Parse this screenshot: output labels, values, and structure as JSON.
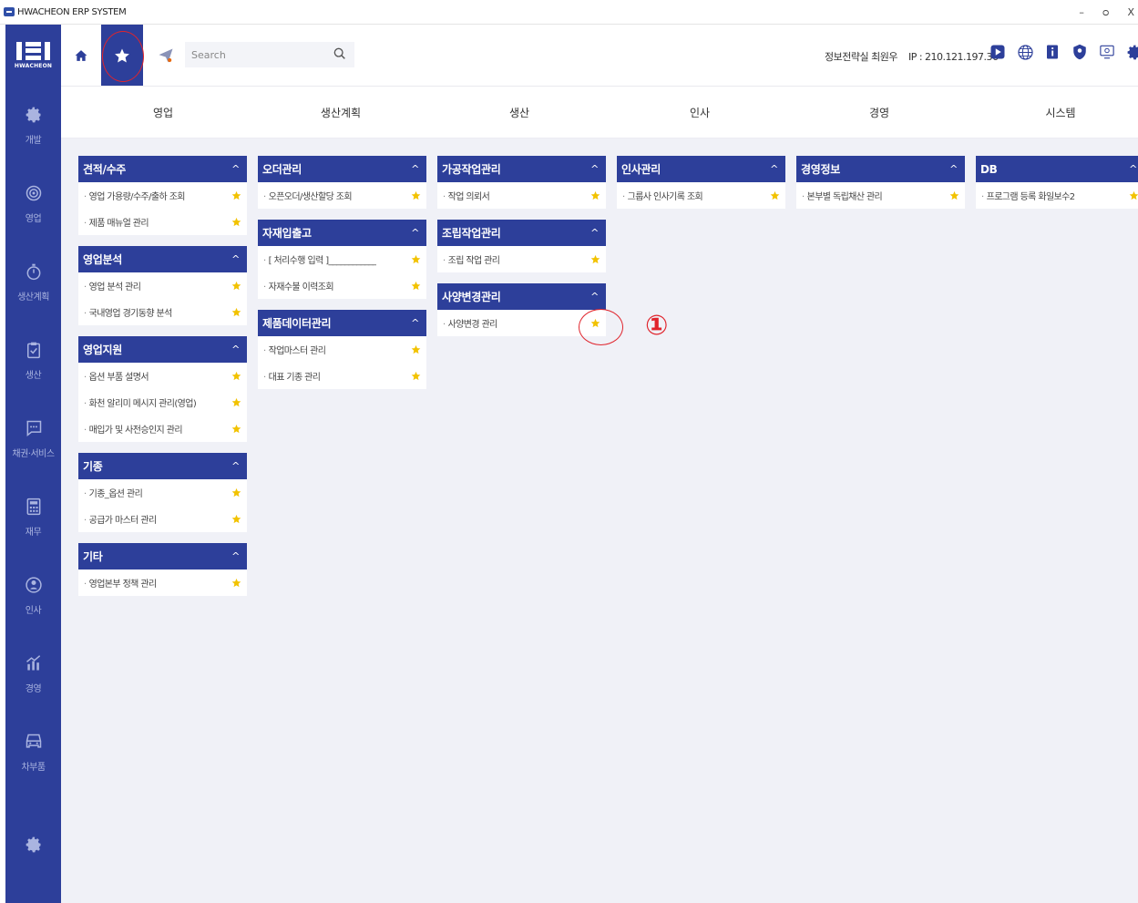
{
  "window": {
    "title": "HWACHEON ERP SYSTEM",
    "controls": [
      "–",
      "ᴑ",
      "X"
    ]
  },
  "sidebar": {
    "brand": "HWACHEON",
    "items": [
      {
        "label": "개발",
        "icon": "gear-bolt-icon"
      },
      {
        "label": "영업",
        "icon": "target-icon"
      },
      {
        "label": "생산계획",
        "icon": "stopwatch-icon"
      },
      {
        "label": "생산",
        "icon": "clipboard-icon"
      },
      {
        "label": "채권·서비스",
        "icon": "chat-bubble-icon"
      },
      {
        "label": "재무",
        "icon": "calculator-icon"
      },
      {
        "label": "인사",
        "icon": "person-icon"
      },
      {
        "label": "경영",
        "icon": "chart-icon"
      },
      {
        "label": "차부품",
        "icon": "car-icon"
      }
    ],
    "settings_icon": "gear-icon"
  },
  "toolbar": {
    "search_placeholder": "Search",
    "user": "정보전략실 최원우",
    "ip": "IP : 210.121.197.36",
    "icons": [
      "play-icon",
      "globe-icon",
      "info-book-icon",
      "shield-icon",
      "monitor-icon",
      "settings-icon"
    ]
  },
  "modules": [
    "영업",
    "생산계획",
    "생산",
    "인사",
    "경영",
    "시스템"
  ],
  "columns": [
    {
      "groups": [
        {
          "title": "견적/수주",
          "items": [
            "영업 가용량/수주/출하 조회",
            "제품 매뉴얼 관리"
          ]
        },
        {
          "title": "영업분석",
          "items": [
            "영업 분석 관리",
            "국내영업 경기동향 분석"
          ]
        },
        {
          "title": "영업지원",
          "items": [
            "옵션 부품 설명서",
            "화천 알리미 메시지 관리(영업)",
            "매입가 및 사전승인지 관리"
          ]
        },
        {
          "title": "기종",
          "items": [
            "기종_옵션 관리",
            "공급가 마스터 관리"
          ]
        },
        {
          "title": "기타",
          "items": [
            "영업본부 정책 관리"
          ]
        }
      ]
    },
    {
      "groups": [
        {
          "title": "오더관리",
          "items": [
            "오픈오더/생산할당 조회"
          ]
        },
        {
          "title": "자재입출고",
          "items": [
            "[ 처리수행 입력 ]____________",
            "자재수불 이력조회"
          ]
        },
        {
          "title": "제품데이터관리",
          "items": [
            "작업마스터 관리",
            "대표 기종 관리"
          ]
        }
      ]
    },
    {
      "groups": [
        {
          "title": "가공작업관리",
          "items": [
            "작업 의뢰서"
          ]
        },
        {
          "title": "조립작업관리",
          "items": [
            "조립 작업 관리"
          ]
        },
        {
          "title": "사양변경관리",
          "items": [
            "사양변경 관리"
          ]
        }
      ]
    },
    {
      "groups": [
        {
          "title": "인사관리",
          "items": [
            "그룹사 인사기록 조회"
          ]
        }
      ]
    },
    {
      "groups": [
        {
          "title": "경영정보",
          "items": [
            "본부별 독립채산 관리"
          ]
        }
      ]
    },
    {
      "groups": [
        {
          "title": "DB",
          "items": [
            "프로그램 등록 화일보수2"
          ]
        }
      ]
    }
  ],
  "annotation": {
    "label": "①"
  },
  "colors": {
    "primary": "#2d3f9a",
    "star": "#f2c200",
    "annotation": "#e0242c"
  }
}
